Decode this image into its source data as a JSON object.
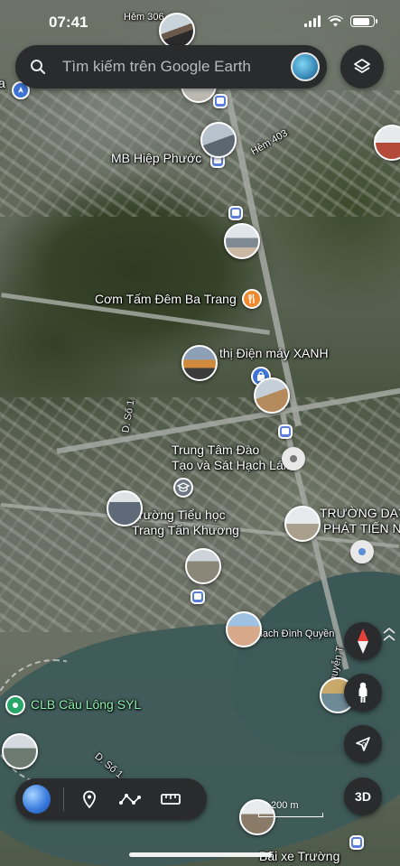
{
  "status_bar": {
    "time": "07:41",
    "battery_level": 0.85
  },
  "search": {
    "placeholder": "Tìm kiếm trên Google Earth"
  },
  "map": {
    "labels": {
      "hem_306": "Hẻm 306",
      "mb_hiep_phuoc": "MB Hiệp Phước",
      "hem_403": "Hẻm 403",
      "com_tam": "Cơm Tấm Đêm Ba Trang",
      "dien_may_xanh": "thị Điện máy XANH",
      "d_so_1": "D. Số 1",
      "trung_tam_dao_tao_1": "Trung Tâm Đào",
      "trung_tam_dao_tao_2": "Tạo và Sát Hạch Lái...",
      "truong_tieu_hoc_1": "Trường Tiểu học",
      "truong_tieu_hoc_2": "Trang Tấn Khương",
      "truong_day_1": "TRƯỜNG DẠY L",
      "truong_day_2": "PHÁT TIẾN N",
      "thach_dinh_quyen": "Thạch Đình Quyền",
      "d_nguyen": "D. Nguyễn T",
      "clb_cau_long": "CLB Cầu Lông SYL",
      "d_so_1b": "D. Số 1",
      "bai_xe_truong": "Bãi xe Trường",
      "left_cut_label": "a"
    },
    "scale": "200 m"
  },
  "controls": {
    "three_d": "3D"
  },
  "colors": {
    "panel": "#2a2b2d",
    "food_pin": "#ef8a2e",
    "transit_pin": "#5b7fd8",
    "place_pin_green": "#2aa568",
    "label_green": "#8ff0b0",
    "compass_red": "#e5413a"
  }
}
